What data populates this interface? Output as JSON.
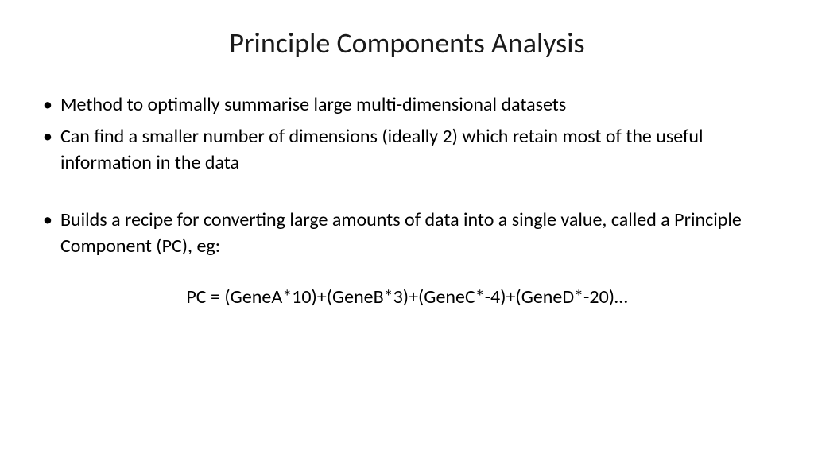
{
  "title": "Principle Components Analysis",
  "bullets": [
    "Method to optimally summarise large multi-dimensional datasets",
    "Can find a smaller number of dimensions (ideally 2) which retain most of the useful information in the data",
    "Builds a recipe for converting large amounts of data into a single value, called a Principle Component (PC), eg:"
  ],
  "formula": "PC = (GeneA*10)+(GeneB*3)+(GeneC*-4)+(GeneD*-20)…"
}
